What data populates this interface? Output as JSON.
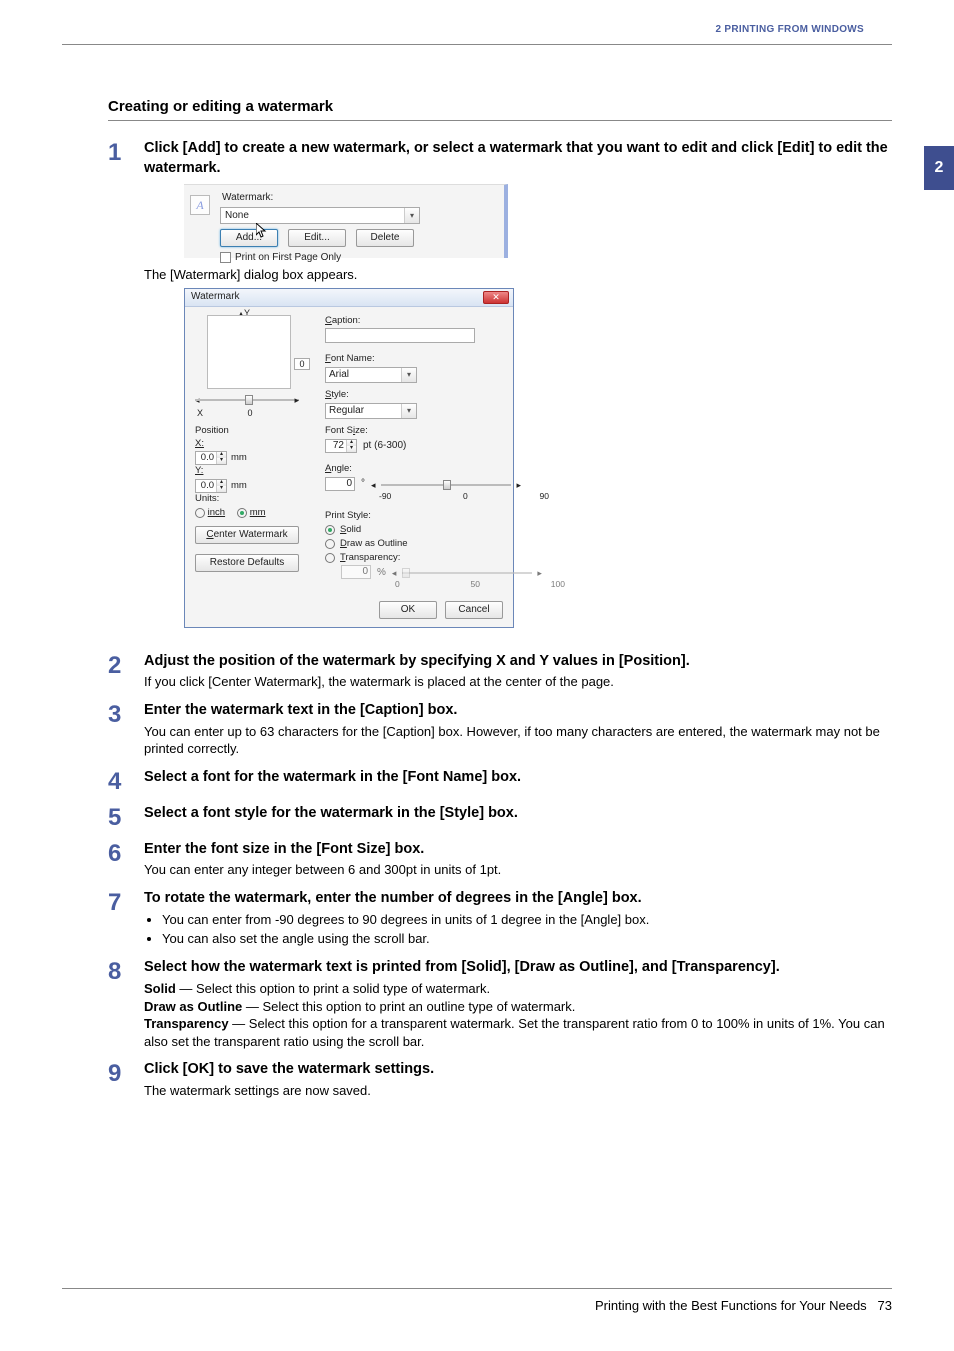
{
  "header": {
    "chapter": "2 PRINTING FROM WINDOWS",
    "sideTab": "2"
  },
  "section": {
    "title": "Creating or editing a watermark"
  },
  "shot1": {
    "label": "Watermark:",
    "dropdown": "None",
    "add": "Add...",
    "edit": "Edit...",
    "delete": "Delete",
    "printFirst": "Print on First Page Only"
  },
  "dlg": {
    "title": "Watermark",
    "caption": "Caption:",
    "fontName": "Font Name:",
    "fontNameVal": "Arial",
    "style": "Style:",
    "styleVal": "Regular",
    "fontSize": "Font Size:",
    "fontSizeVal": "72",
    "fontSizeUnit": "pt (6-300)",
    "angle": "Angle:",
    "angleVal": "0",
    "angleDeg": "°",
    "angleMin": "-90",
    "angleMid": "0",
    "angleMax": "90",
    "printStyle": "Print Style:",
    "solid": "Solid",
    "outline": "Draw as Outline",
    "transparency": "Transparency:",
    "transVal": "0",
    "pct": "%",
    "t0": "0",
    "t50": "50",
    "t100": "100",
    "axisY": "Y",
    "axisX": "X",
    "zero": "0",
    "position": "Position",
    "xLbl": "X:",
    "yLbl": "Y:",
    "xv": "0.0",
    "yv": "0.0",
    "mm": "mm",
    "units": "Units:",
    "inch": "inch",
    "mmOpt": "mm",
    "center": "Center Watermark",
    "restore": "Restore Defaults",
    "ok": "OK",
    "cancel": "Cancel"
  },
  "steps": {
    "s1": {
      "num": "1",
      "head": "Click [Add] to create a new watermark, or select a watermark that you want to edit and click [Edit] to edit the watermark.",
      "caption": "The [Watermark] dialog box appears."
    },
    "s2": {
      "num": "2",
      "head": "Adjust the position of the watermark by specifying X and Y values in [Position].",
      "note": "If you click [Center Watermark], the watermark is placed at the center of the page."
    },
    "s3": {
      "num": "3",
      "head": "Enter the watermark text in the [Caption] box.",
      "note": "You can enter up to 63 characters for the [Caption] box. However, if too many characters are entered, the watermark may not be printed correctly."
    },
    "s4": {
      "num": "4",
      "head": "Select a font for the watermark in the [Font Name] box."
    },
    "s5": {
      "num": "5",
      "head": "Select a font style for the watermark in the [Style] box."
    },
    "s6": {
      "num": "6",
      "head": "Enter the font size in the [Font Size] box.",
      "note": "You can enter any integer between 6 and 300pt in units of 1pt."
    },
    "s7": {
      "num": "7",
      "head": "To rotate the watermark, enter the number of degrees in the [Angle] box.",
      "b1": "You can enter from -90 degrees to 90 degrees in units of 1 degree in the [Angle] box.",
      "b2": "You can also set the angle using the scroll bar."
    },
    "s8": {
      "num": "8",
      "head": "Select how the watermark text is printed from [Solid], [Draw as Outline], and [Transparency].",
      "solidLbl": "Solid",
      "solidTxt": " — Select this option to print a solid type of watermark.",
      "outlineLbl": "Draw as Outline",
      "outlineTxt": " — Select this option to print an outline type of watermark.",
      "transLbl": "Transparency",
      "transTxt": " — Select this option for a transparent watermark. Set the transparent ratio from 0 to 100% in units of 1%. You can also set the transparent ratio using the scroll bar."
    },
    "s9": {
      "num": "9",
      "head": "Click [OK] to save the watermark settings.",
      "note": "The watermark settings are now saved."
    }
  },
  "footer": {
    "text": "Printing with the Best Functions for Your Needs",
    "page": "73"
  }
}
